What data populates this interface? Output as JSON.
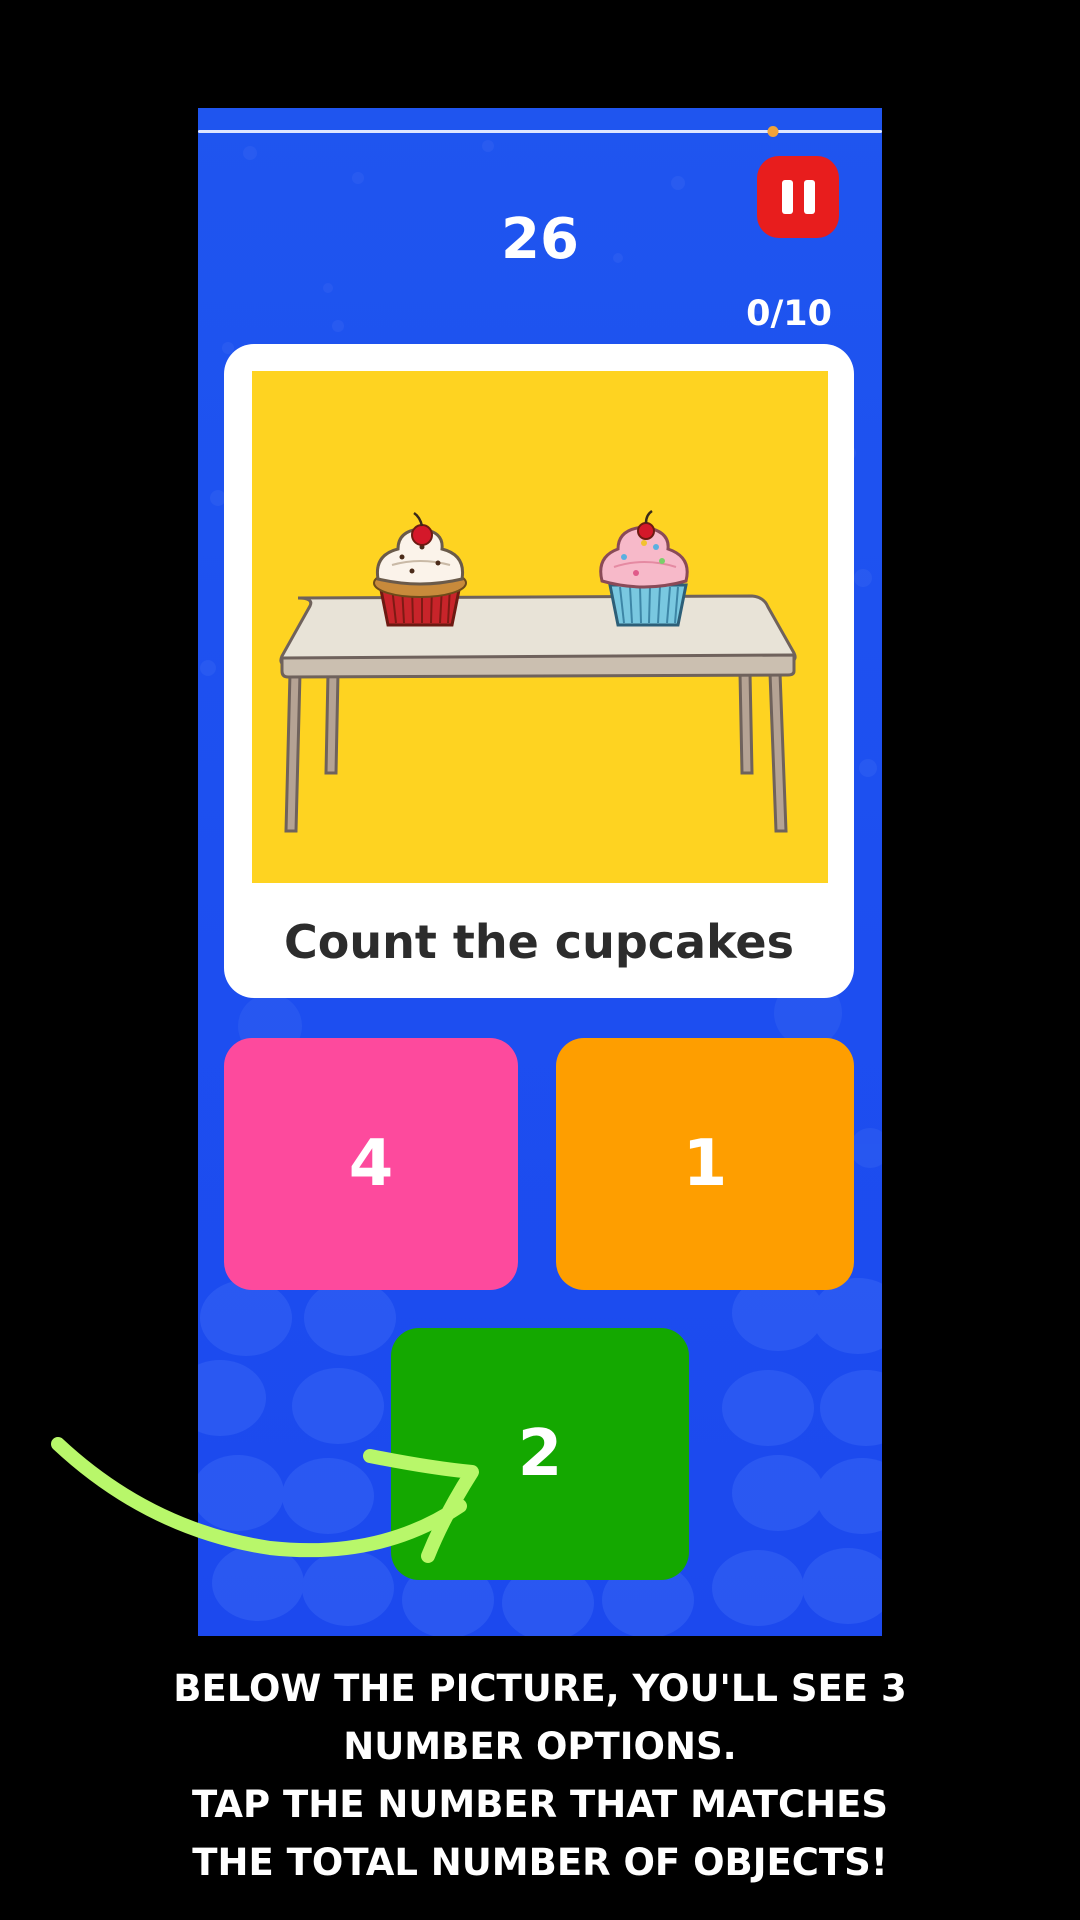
{
  "game": {
    "timer": "26",
    "score": "0/10",
    "progress": 0.84,
    "prompt": "Count the cupcakes",
    "options": [
      {
        "label": "4",
        "color": "#fd4a9d"
      },
      {
        "label": "1",
        "color": "#fe9e00"
      },
      {
        "label": "2",
        "color": "#14a800"
      }
    ]
  },
  "instructions": {
    "lines": [
      "BELOW THE PICTURE, YOU'LL SEE 3",
      "NUMBER OPTIONS.",
      "TAP THE NUMBER THAT MATCHES",
      "THE TOTAL NUMBER OF OBJECTS!"
    ]
  },
  "icons": {
    "pause": "pause-icon",
    "arrow": "curved-arrow-icon"
  },
  "colors": {
    "background": "#1f55ef",
    "pause_button": "#e81d1d",
    "picture_background": "#fed321",
    "arrow": "#b8f76a"
  }
}
